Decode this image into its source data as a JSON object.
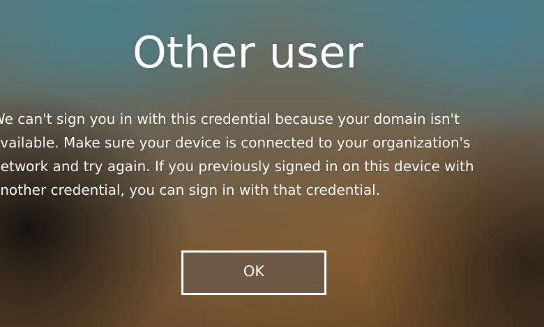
{
  "screen": {
    "title": "Other user",
    "message_lines": [
      "We can't sign you in with this credential because your domain isn't",
      "available. Make sure your device is connected to your organization's",
      "network and try again. If you previously signed in on this device with",
      "another credential, you can sign in with that credential."
    ],
    "ok_label": "OK"
  }
}
